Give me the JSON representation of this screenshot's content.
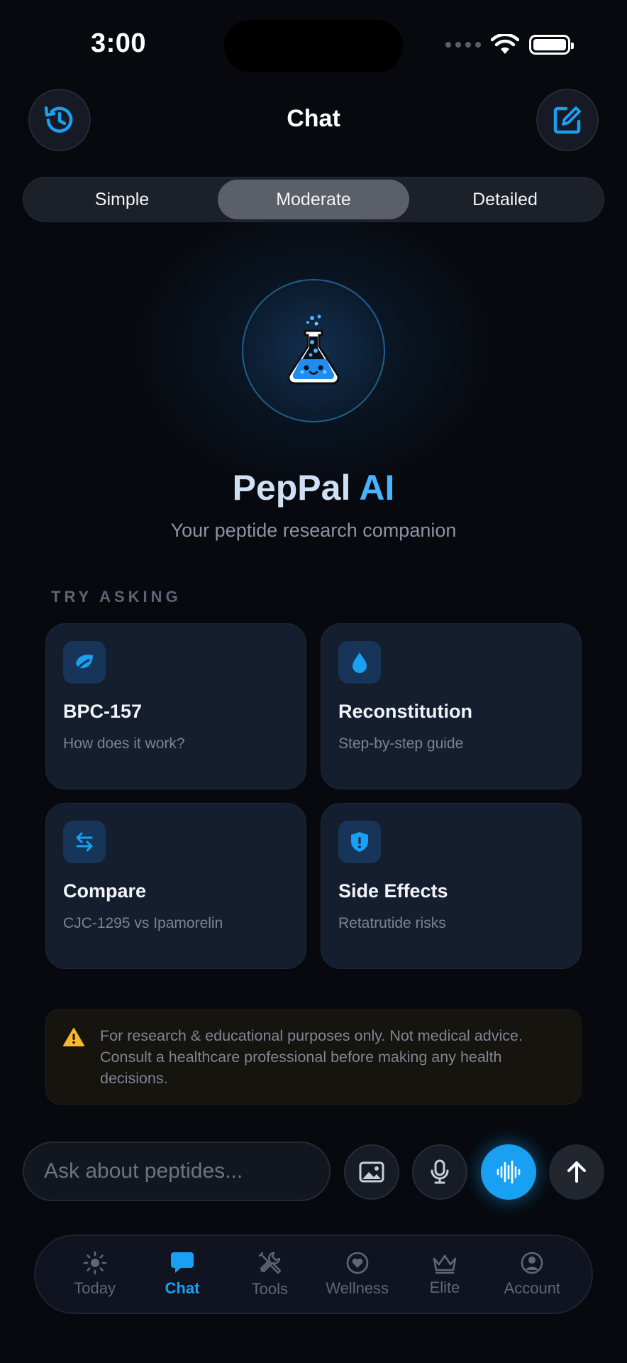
{
  "status_bar": {
    "time": "3:00"
  },
  "header": {
    "title": "Chat"
  },
  "modes": [
    {
      "label": "Simple",
      "active": false
    },
    {
      "label": "Moderate",
      "active": true
    },
    {
      "label": "Detailed",
      "active": false
    }
  ],
  "hero": {
    "title_part1": "PepPal",
    "title_part2": "AI",
    "subtitle": "Your peptide research companion"
  },
  "suggestions": {
    "label": "TRY ASKING",
    "cards": [
      {
        "icon": "leaf-icon",
        "title": "BPC-157",
        "subtitle": "How does it work?"
      },
      {
        "icon": "droplet-icon",
        "title": "Reconstitution",
        "subtitle": "Step-by-step guide"
      },
      {
        "icon": "arrows-swap-icon",
        "title": "Compare",
        "subtitle": "CJC-1295 vs Ipamorelin"
      },
      {
        "icon": "shield-alert-icon",
        "title": "Side Effects",
        "subtitle": "Retatrutide risks"
      }
    ]
  },
  "disclaimer": {
    "text": "For research & educational purposes only. Not medical advice. Consult a healthcare professional before making any health decisions."
  },
  "composer": {
    "placeholder": "Ask about peptides...",
    "value": ""
  },
  "tabs": [
    {
      "label": "Today",
      "icon": "sun-icon",
      "active": false
    },
    {
      "label": "Chat",
      "icon": "chat-bubble-icon",
      "active": true
    },
    {
      "label": "Tools",
      "icon": "tools-icon",
      "active": false
    },
    {
      "label": "Wellness",
      "icon": "heart-icon",
      "active": false
    },
    {
      "label": "Elite",
      "icon": "crown-icon",
      "active": false
    },
    {
      "label": "Account",
      "icon": "person-icon",
      "active": false
    }
  ],
  "colors": {
    "accent": "#19a0f2",
    "background": "#07090e",
    "card": "#151e2e",
    "warning": "#f5b82e"
  }
}
